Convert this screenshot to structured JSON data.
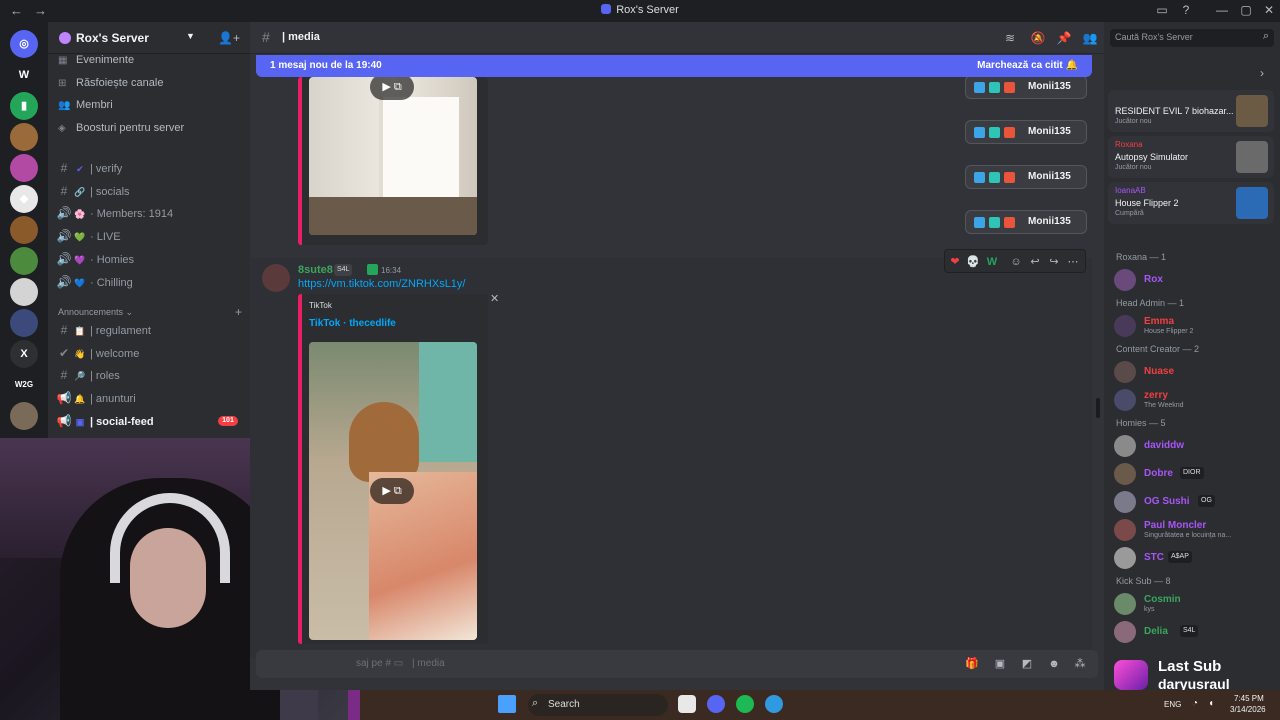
{
  "window": {
    "title": "Rox's Server"
  },
  "rail": {
    "servers": [
      {
        "name": "discord-home",
        "glyph": "◎",
        "color": "#5865f2",
        "badge": "280"
      },
      {
        "name": "server-w",
        "glyph": "W",
        "color": "#1e1f22",
        "badge": ""
      },
      {
        "name": "server-green",
        "glyph": "▮",
        "color": "#23a55a",
        "badge": "1"
      },
      {
        "name": "server-fire",
        "glyph": "",
        "color": "#9b6a3a",
        "badge": "12"
      },
      {
        "name": "server-rox",
        "glyph": "",
        "color": "#b24aa3",
        "badge": "101"
      },
      {
        "name": "server-white",
        "glyph": "◆",
        "color": "#e8e8e8",
        "badge": ""
      },
      {
        "name": "server-avatar",
        "glyph": "",
        "color": "#8b5a2b",
        "badge": "2"
      },
      {
        "name": "server-nature",
        "glyph": "",
        "color": "#4c8a3e",
        "badge": ""
      },
      {
        "name": "server-dog",
        "glyph": "",
        "color": "#d4d4d4",
        "badge": "64"
      },
      {
        "name": "server-anime",
        "glyph": "",
        "color": "#3b4a7a",
        "badge": "541"
      },
      {
        "name": "server-x",
        "glyph": "X",
        "color": "#2e2f33",
        "badge": ""
      },
      {
        "name": "server-w2g",
        "glyph": "W2G",
        "color": "#1e1f22",
        "badge": ""
      },
      {
        "name": "server-last",
        "glyph": "",
        "color": "#7a6a5a",
        "badge": ""
      }
    ]
  },
  "sidebar": {
    "server_name": "Rox's Server",
    "nav": [
      {
        "icon": "calendar-icon",
        "glyph": "▦",
        "label": "Evenimente"
      },
      {
        "icon": "browse-icon",
        "glyph": "⊞",
        "label": "Răsfoiește canale"
      },
      {
        "icon": "members-icon",
        "glyph": "👥",
        "label": "Membri"
      },
      {
        "icon": "boost-icon",
        "glyph": "◈",
        "label": "Boosturi pentru server"
      }
    ],
    "channels": [
      {
        "type": "#",
        "emoji": "✔",
        "emoji_color": "#5865f2",
        "label": "| verify"
      },
      {
        "type": "#",
        "emoji": "🔗",
        "emoji_color": "#b5bac1",
        "label": "| socials"
      },
      {
        "type": "🔊",
        "emoji": "🌸",
        "emoji_color": "#f47fff",
        "label": "· Members: 1914"
      },
      {
        "type": "🔊",
        "emoji": "💚",
        "emoji_color": "#23a55a",
        "label": "· LIVE"
      },
      {
        "type": "🔊",
        "emoji": "💜",
        "emoji_color": "#a855f7",
        "label": "· Homies"
      },
      {
        "type": "🔊",
        "emoji": "💙",
        "emoji_color": "#3b82f6",
        "label": "· Chilling"
      }
    ],
    "category": "Announcements",
    "announcements": [
      {
        "type": "#",
        "emoji": "📋",
        "emoji_color": "#b5bac1",
        "label": "| regulament",
        "badge": ""
      },
      {
        "type": "✔",
        "emoji": "👋",
        "emoji_color": "#f0b132",
        "label": "| welcome",
        "badge": ""
      },
      {
        "type": "#",
        "emoji": "🔎",
        "emoji_color": "#b5bac1",
        "label": "| roles",
        "badge": ""
      },
      {
        "type": "📢",
        "emoji": "🔔",
        "emoji_color": "#f0b132",
        "label": "| anunturi",
        "badge": ""
      },
      {
        "type": "📢",
        "emoji": "▣",
        "emoji_color": "#5865f2",
        "label": "| social-feed",
        "badge": "101"
      }
    ]
  },
  "chat": {
    "channel_name": "| media",
    "new_messages_bar": {
      "text": "1 mesaj nou de la 19:40",
      "action": "Marchează ca citit"
    },
    "message": {
      "author": "8sute8",
      "tag": "S4L",
      "time": "16:34",
      "link": "https://vm.tiktok.com/ZNRHXsL1y/",
      "embed_provider": "TikTok",
      "embed_title": "TikTok · thecedlife"
    },
    "composer_placeholder": "saj pe #",
    "composer_channel": "| media",
    "pills": [
      {
        "label": "Monii135"
      },
      {
        "label": "Monii135"
      },
      {
        "label": "Monii135"
      },
      {
        "label": "Monii135"
      }
    ],
    "reaction_W": "W"
  },
  "members": {
    "search_placeholder": "Caută Rox's Server",
    "activities": [
      {
        "title": "RESIDENT EVIL 7 biohazar...",
        "sub": "Jucător nou",
        "color": "#6b5a44"
      },
      {
        "title": "Autopsy Simulator",
        "sub": "Jucător nou",
        "color": "#6a6a6a",
        "user": "Roxana"
      },
      {
        "title": "House Flipper 2",
        "sub": "Cumpără",
        "color": "#2b6ab5",
        "user": "IoanaAB"
      }
    ],
    "groups": [
      {
        "header": "Roxana — 1",
        "items": [
          {
            "name": "Rox",
            "color": "#a855f7",
            "sub": "",
            "av": "#6a4a7a"
          }
        ]
      },
      {
        "header": "Head Admin — 1",
        "items": [
          {
            "name": "Emma",
            "color": "#f23f43",
            "sub": "House Flipper 2",
            "av": "#4a3a5a"
          }
        ]
      },
      {
        "header": "Content Creator — 2",
        "items": [
          {
            "name": "Nuase",
            "color": "#f23f43",
            "sub": "",
            "av": "#5a4a4a"
          },
          {
            "name": "zerry",
            "color": "#f23f43",
            "sub": "The Weeknd",
            "av": "#4a4a6a"
          }
        ]
      },
      {
        "header": "Homies — 5",
        "items": [
          {
            "name": "daviddw",
            "color": "#a855f7",
            "sub": "",
            "av": "#8a8a8a",
            "tag": ""
          },
          {
            "name": "Dobre",
            "color": "#a855f7",
            "sub": "",
            "av": "#6a5a4a",
            "tag": "DIOR"
          },
          {
            "name": "OG Sushi",
            "color": "#a855f7",
            "sub": "",
            "av": "#7a7a8a",
            "tag": "OG"
          },
          {
            "name": "Paul Moncler",
            "color": "#a855f7",
            "sub": "Singurătatea e locuința na...",
            "av": "#7a4a4a",
            "tag": ""
          },
          {
            "name": "STC",
            "color": "#a855f7",
            "sub": "",
            "av": "#9a9a9a",
            "tag": "A$AP"
          }
        ]
      },
      {
        "header": "Kick Sub — 8",
        "items": [
          {
            "name": "Cosmin",
            "color": "#3ba55c",
            "sub": "kys",
            "av": "#6a8a6a"
          },
          {
            "name": "Delia",
            "color": "#3ba55c",
            "sub": "",
            "av": "#8a6a7a",
            "tag": "S4L"
          }
        ]
      }
    ],
    "overlay": {
      "line1": "Last Sub",
      "line2": "daryusraul"
    }
  },
  "taskbar": {
    "search": "Search",
    "lang": "ENG",
    "time": "7:45 PM",
    "date": "3/14/2026"
  }
}
